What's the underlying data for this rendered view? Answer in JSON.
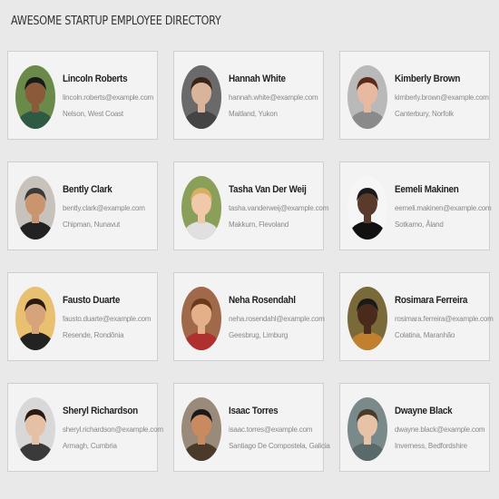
{
  "title": "AWESOME STARTUP EMPLOYEE DIRECTORY",
  "employees": [
    {
      "name": "Lincoln Roberts",
      "email": "lincoln.roberts@example.com",
      "location": "Nelson, West Coast",
      "avatar": "avatar-photo",
      "bg": "#6a8a4a",
      "skin": "#8a5a3a",
      "hair": "#1a1a1a",
      "shirt": "#2e5a44"
    },
    {
      "name": "Hannah White",
      "email": "hannah.white@example.com",
      "location": "Maitland, Yukon",
      "avatar": "avatar-photo",
      "bg": "#6a6a6a",
      "skin": "#d9b49a",
      "hair": "#3a2418",
      "shirt": "#444444"
    },
    {
      "name": "Kimberly Brown",
      "email": "kimberly.brown@example.com",
      "location": "Canterbury, Norfolk",
      "avatar": "avatar-photo",
      "bg": "#b9b9b9",
      "skin": "#e6b9a0",
      "hair": "#5a2a1a",
      "shirt": "#8a8a8a"
    },
    {
      "name": "Bently Clark",
      "email": "bently.clark@example.com",
      "location": "Chipman, Nunavut",
      "avatar": "avatar-photo",
      "bg": "#c7c2bb",
      "skin": "#c9946e",
      "hair": "#3a3a3a",
      "shirt": "#222222"
    },
    {
      "name": "Tasha Van Der Weij",
      "email": "tasha.vanderweij@example.com",
      "location": "Makkum, Flevoland",
      "avatar": "avatar-photo",
      "bg": "#8aa05a",
      "skin": "#f0c9a8",
      "hair": "#d9b060",
      "shirt": "#e0e0e0"
    },
    {
      "name": "Eemeli Makinen",
      "email": "eemeli.makinen@example.com",
      "location": "Sotkamo, Åland",
      "avatar": "avatar-photo",
      "bg": "#f6f6f6",
      "skin": "#5a3a2a",
      "hair": "#1a1a1a",
      "shirt": "#111111"
    },
    {
      "name": "Fausto Duarte",
      "email": "fausto.duarte@example.com",
      "location": "Resende, Rondônia",
      "avatar": "avatar-photo",
      "bg": "#e8c070",
      "skin": "#d6a37a",
      "hair": "#2a1a10",
      "shirt": "#222222"
    },
    {
      "name": "Neha Rosendahl",
      "email": "neha.rosendahl@example.com",
      "location": "Geesbrug, Limburg",
      "avatar": "avatar-photo",
      "bg": "#a06a4a",
      "skin": "#e3b08a",
      "hair": "#6a3a1a",
      "shirt": "#b03030"
    },
    {
      "name": "Rosimara Ferreira",
      "email": "rosimara.ferreira@example.com",
      "location": "Colatina, Maranhão",
      "avatar": "avatar-photo",
      "bg": "#7a6a3a",
      "skin": "#4a2a1a",
      "hair": "#1a1a1a",
      "shirt": "#c08030"
    },
    {
      "name": "Sheryl Richardson",
      "email": "sheryl.richardson@example.com",
      "location": "Armagh, Cumbria",
      "avatar": "avatar-photo",
      "bg": "#d8d8d8",
      "skin": "#e6c0a4",
      "hair": "#2a1a14",
      "shirt": "#3a3a3a"
    },
    {
      "name": "Isaac Torres",
      "email": "isaac.torres@example.com",
      "location": "Santiago De Compostela, Galicia",
      "avatar": "avatar-photo",
      "bg": "#9a8a7a",
      "skin": "#c98a60",
      "hair": "#1a1a1a",
      "shirt": "#4a3a2a"
    },
    {
      "name": "Dwayne Black",
      "email": "dwayne.black@example.com",
      "location": "Inverness, Bedfordshire",
      "avatar": "avatar-photo",
      "bg": "#7a8a8a",
      "skin": "#e6c2a6",
      "hair": "#4a3a2a",
      "shirt": "#5a6a6a"
    }
  ]
}
